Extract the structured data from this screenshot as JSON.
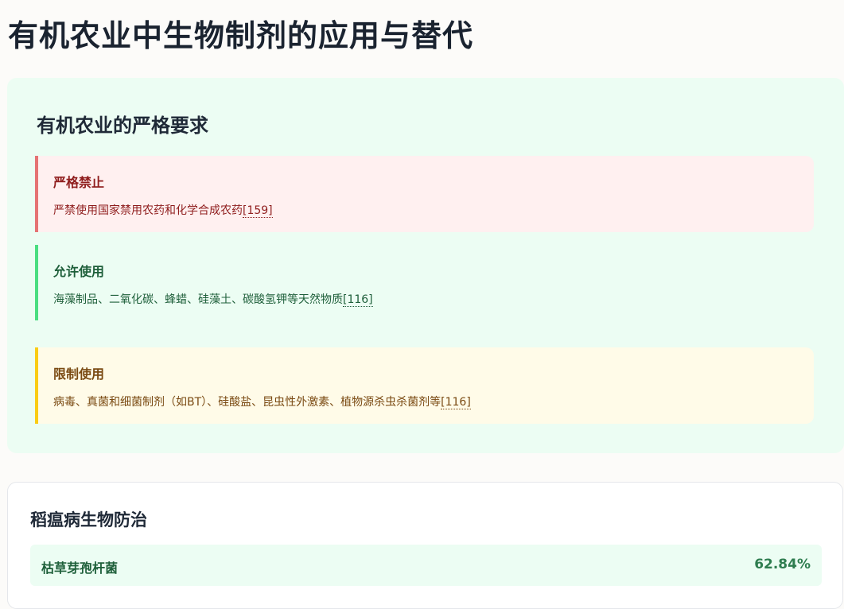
{
  "page": {
    "title": "有机农业中生物制剂的应用与替代"
  },
  "requirements": {
    "title": "有机农业的严格要求",
    "banned": {
      "title": "严格禁止",
      "text": "严禁使用国家禁用农药和化学合成农药",
      "cite": "[159]",
      "color": "#e57373"
    },
    "allowed": {
      "title": "允许使用",
      "text": "海藻制品、二氧化碳、蜂蜡、硅藻土、碳酸氢钾等天然物质",
      "cite": "[116]",
      "color": "#4ade80"
    },
    "limited": {
      "title": "限制使用",
      "text": "病毒、真菌和细菌制剂（如BT）、硅酸盐、昆虫性外激素、植物源杀虫杀菌剂等",
      "cite": "[116]",
      "color": "#facc15"
    }
  },
  "rice_blast": {
    "title": "稻瘟病生物防治",
    "agents": [
      {
        "name": "枯草芽孢杆菌",
        "value": "62.84%"
      }
    ]
  }
}
